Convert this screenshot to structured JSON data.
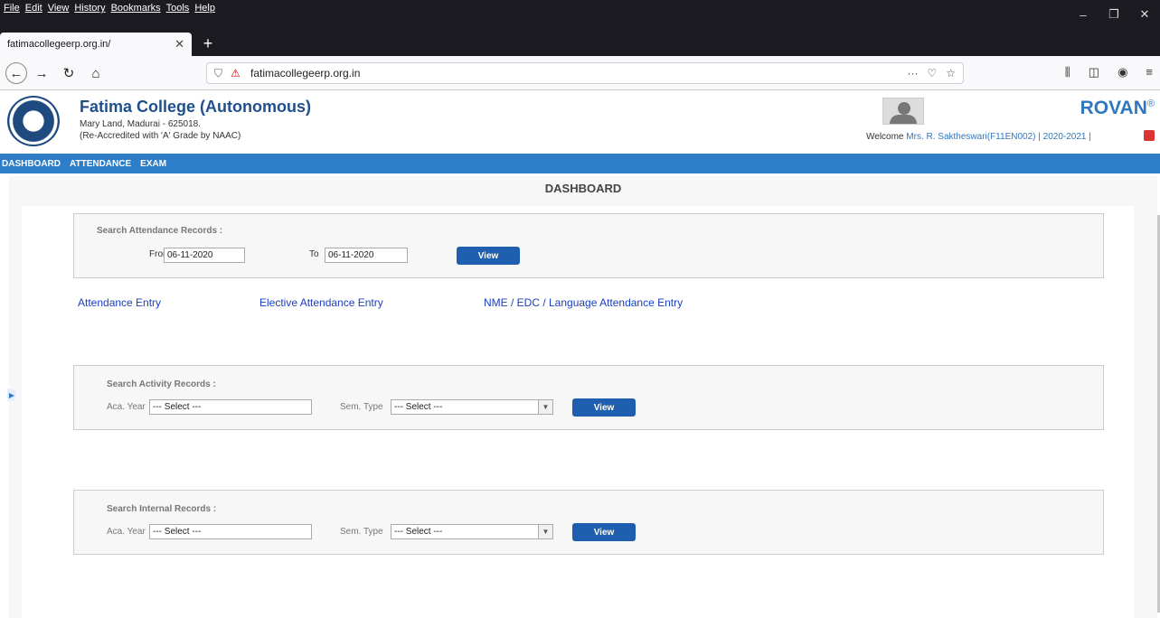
{
  "browser": {
    "menu": [
      "File",
      "Edit",
      "View",
      "History",
      "Bookmarks",
      "Tools",
      "Help"
    ],
    "tab_title": "fatimacollegeerp.org.in/",
    "url": "fatimacollegeerp.org.in"
  },
  "header": {
    "college_name": "Fatima College (Autonomous)",
    "address": "Mary Land, Madurai - 625018.",
    "accreditation": "(Re-Accredited with 'A' Grade by NAAC)",
    "brand": "ROVAN",
    "brand_mark": "®",
    "welcome_label": "Welcome",
    "user_name": "Mrs. R. Saktheswari(F11EN002)",
    "year": "| 2020-2021 |"
  },
  "nav": [
    "DASHBOARD",
    "ATTENDANCE",
    "EXAM"
  ],
  "main": {
    "title": "DASHBOARD",
    "attendance_search": {
      "title": "Search Attendance Records :",
      "from_label": "From",
      "from_value": "06-11-2020",
      "to_label": "To",
      "to_value": "06-11-2020",
      "button": "View"
    },
    "links": [
      "Attendance Entry",
      "Elective Attendance Entry",
      "NME / EDC / Language Attendance Entry"
    ],
    "activity_search": {
      "title": "Search Activity Records :",
      "year_label": "Aca. Year",
      "year_value": "--- Select ---",
      "sem_label": "Sem. Type",
      "sem_value": "--- Select ---",
      "button": "View"
    },
    "internal_search": {
      "title": "Search Internal Records :",
      "year_label": "Aca. Year",
      "year_value": "--- Select ---",
      "sem_label": "Sem. Type",
      "sem_value": "--- Select ---",
      "button": "View"
    }
  }
}
